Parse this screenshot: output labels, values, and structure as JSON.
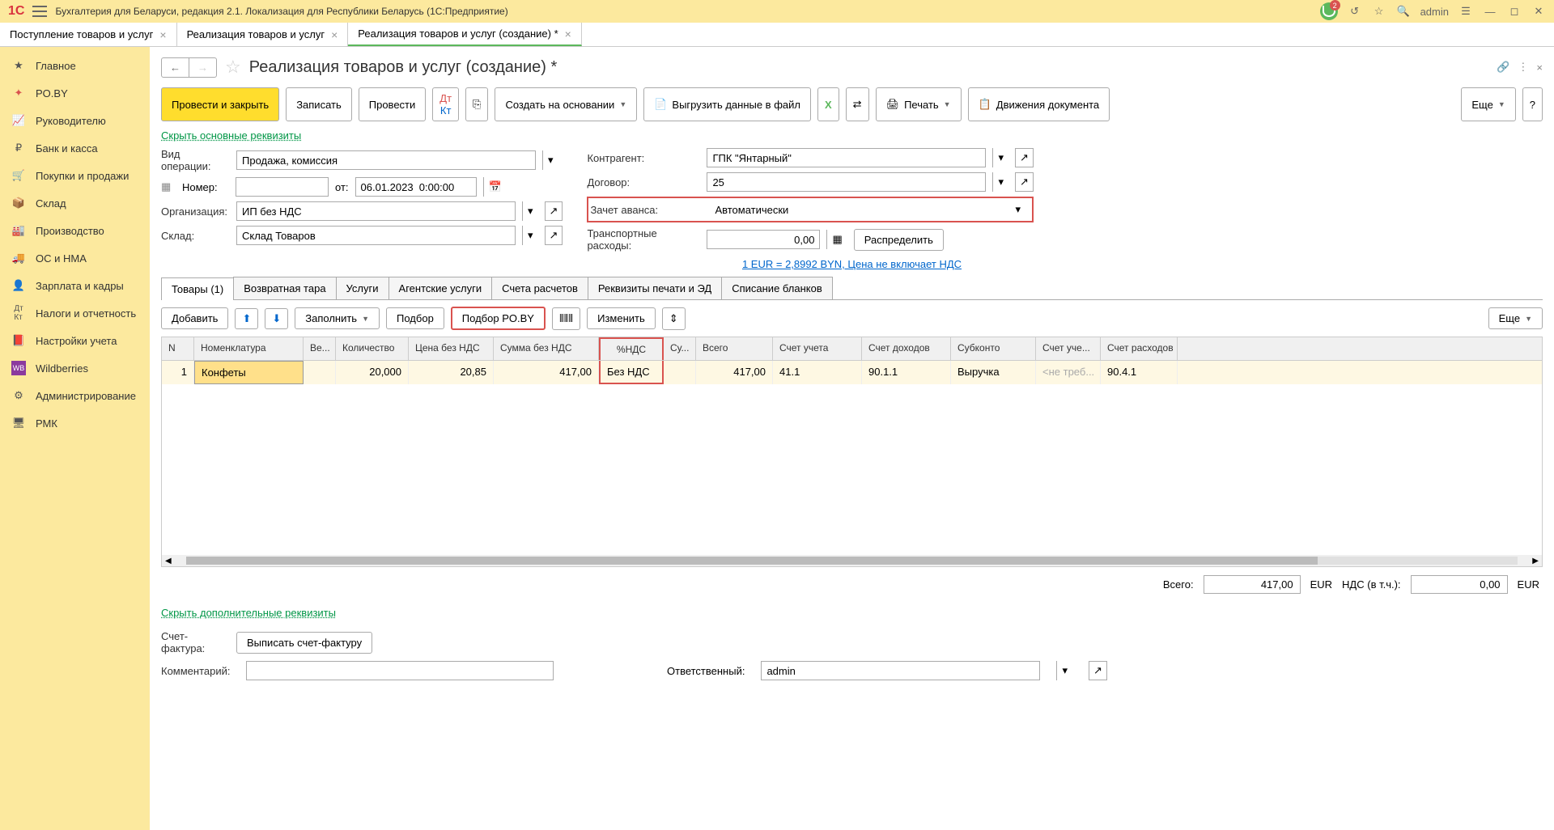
{
  "titlebar": {
    "title": "Бухгалтерия для Беларуси, редакция 2.1. Локализация для Республики Беларусь   (1С:Предприятие)",
    "notif_count": "2",
    "user": "admin"
  },
  "nav_tabs": [
    {
      "label": "Поступление товаров и услуг"
    },
    {
      "label": "Реализация товаров и услуг"
    },
    {
      "label": "Реализация товаров и услуг (создание) *",
      "active": true
    }
  ],
  "sidebar": [
    {
      "icon": "star",
      "label": "Главное"
    },
    {
      "icon": "poby",
      "label": "PO.BY"
    },
    {
      "icon": "chart",
      "label": "Руководителю"
    },
    {
      "icon": "coin",
      "label": "Банк и касса"
    },
    {
      "icon": "cart",
      "label": "Покупки и продажи"
    },
    {
      "icon": "box",
      "label": "Склад"
    },
    {
      "icon": "factory",
      "label": "Производство"
    },
    {
      "icon": "truck",
      "label": "ОС и НМА"
    },
    {
      "icon": "person",
      "label": "Зарплата и кадры"
    },
    {
      "icon": "tax",
      "label": "Налоги и отчетность"
    },
    {
      "icon": "book",
      "label": "Настройки учета"
    },
    {
      "icon": "wb",
      "label": "Wildberries"
    },
    {
      "icon": "gear",
      "label": "Администрирование"
    },
    {
      "icon": "pmk",
      "label": "РМК"
    }
  ],
  "page": {
    "title": "Реализация товаров и услуг (создание) *",
    "hide_link": "Скрыть основные реквизиты",
    "hide_link2": "Скрыть дополнительные реквизиты",
    "currency_link": "1 EUR = 2,8992 BYN, Цена не включает НДС"
  },
  "cmd": {
    "post_close": "Провести и закрыть",
    "save": "Записать",
    "post": "Провести",
    "create_from": "Создать на основании",
    "export": "Выгрузить данные в файл",
    "print": "Печать",
    "movements": "Движения документа",
    "more": "Еще"
  },
  "form": {
    "op_label": "Вид операции:",
    "op_value": "Продажа, комиссия",
    "num_label": "Номер:",
    "from_label": "от:",
    "date_value": "06.01.2023  0:00:00",
    "org_label": "Организация:",
    "org_value": "ИП без НДС",
    "wh_label": "Склад:",
    "wh_value": "Склад Товаров",
    "partner_label": "Контрагент:",
    "partner_value": "ГПК \"Янтарный\"",
    "contract_label": "Договор:",
    "contract_value": "25",
    "advance_label": "Зачет аванса:",
    "advance_value": "Автоматически",
    "transport_label": "Транспортные расходы:",
    "transport_value": "0,00",
    "distribute": "Распределить"
  },
  "doc_tabs": [
    "Товары (1)",
    "Возвратная тара",
    "Услуги",
    "Агентские услуги",
    "Счета расчетов",
    "Реквизиты печати и ЭД",
    "Списание бланков"
  ],
  "tab_cmd": {
    "add": "Добавить",
    "fill": "Заполнить",
    "pick": "Подбор",
    "pick_poby": "Подбор PO.BY",
    "change": "Изменить",
    "more": "Еще"
  },
  "grid": {
    "headers": [
      "N",
      "Номенклатура",
      "Ве...",
      "Количество",
      "Цена без НДС",
      "Сумма без НДС",
      "%НДС",
      "Су...",
      "Всего",
      "Счет учета",
      "Счет доходов",
      "Субконто",
      "Счет уче...",
      "Счет расходов"
    ],
    "row": {
      "n": "1",
      "nom": "Конфеты",
      "qty": "20,000",
      "price": "20,85",
      "sum": "417,00",
      "vat": "Без НДС",
      "total": "417,00",
      "acc": "41.1",
      "inc": "90.1.1",
      "sub": "Выручка",
      "acc2": "<не треб...",
      "exp": "90.4.1"
    }
  },
  "totals": {
    "total_label": "Всего:",
    "total_value": "417,00",
    "cur1": "EUR",
    "vat_label": "НДС (в т.ч.):",
    "vat_value": "0,00",
    "cur2": "EUR"
  },
  "bottom": {
    "invoice_label": "Счет-фактура:",
    "invoice_btn": "Выписать счет-фактуру",
    "comment_label": "Комментарий:",
    "resp_label": "Ответственный:",
    "resp_value": "admin"
  }
}
